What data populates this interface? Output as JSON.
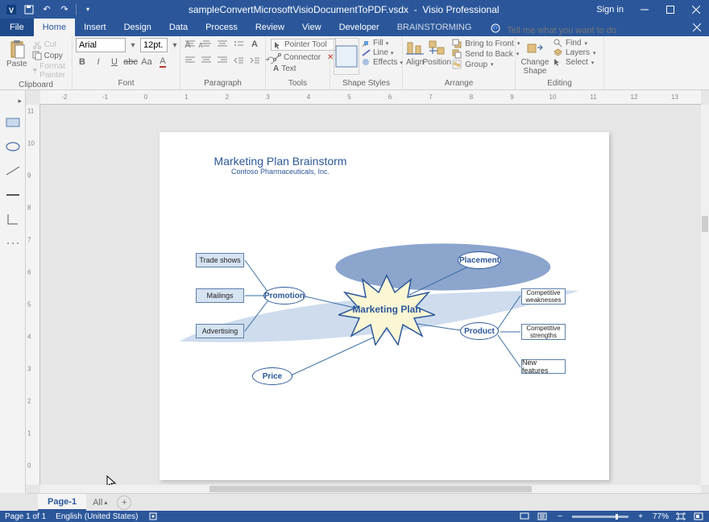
{
  "title": {
    "filename": "sampleConvertMicrosoftVisioDocumentToPDF.vsdx",
    "app": "Visio Professional",
    "signin": "Sign in"
  },
  "tabs": {
    "file": "File",
    "home": "Home",
    "insert": "Insert",
    "design": "Design",
    "data": "Data",
    "process": "Process",
    "review": "Review",
    "view": "View",
    "developer": "Developer",
    "brainstorming": "BRAINSTORMING",
    "tellme": "Tell me what you want to do"
  },
  "ribbon": {
    "clipboard": {
      "paste": "Paste",
      "cut": "Cut",
      "copy": "Copy",
      "format_painter": "Format Painter",
      "label": "Clipboard"
    },
    "font": {
      "name": "Arial",
      "size": "12pt.",
      "label": "Font"
    },
    "paragraph": {
      "label": "Paragraph"
    },
    "tools": {
      "pointer": "Pointer Tool",
      "connector": "Connector",
      "text": "Text",
      "label": "Tools"
    },
    "shapestyles": {
      "quick": "Quick\nStyles",
      "fill": "Fill",
      "line": "Line",
      "effects": "Effects",
      "label": "Shape Styles"
    },
    "arrange": {
      "align": "Align",
      "position": "Position",
      "bring_front": "Bring to Front",
      "send_back": "Send to Back",
      "group": "Group",
      "label": "Arrange"
    },
    "editing": {
      "change_shape": "Change\nShape",
      "find": "Find",
      "layers": "Layers",
      "select": "Select",
      "label": "Editing"
    }
  },
  "ruler_h": [
    "-2",
    "-1",
    "0",
    "1",
    "2",
    "3",
    "4",
    "5",
    "6",
    "7",
    "8",
    "9",
    "10",
    "11",
    "12",
    "13"
  ],
  "ruler_v": [
    "11",
    "10",
    "9",
    "8",
    "7",
    "6",
    "5",
    "4",
    "3",
    "2",
    "1",
    "0"
  ],
  "diagram": {
    "title": "Marketing Plan Brainstorm",
    "subtitle": "Contoso Pharmaceuticals, Inc.",
    "center": "Marketing Plan",
    "promotion": "Promotion",
    "price": "Price",
    "placement": "Placement",
    "product": "Product",
    "trade_shows": "Trade shows",
    "mailings": "Mailings",
    "advertising": "Advertising",
    "comp_weak": "Competitive weaknesses",
    "comp_str": "Competitive strengths",
    "new_features": "New features"
  },
  "pagetab": {
    "page1": "Page-1",
    "all": "All"
  },
  "status": {
    "page": "Page 1 of 1",
    "lang": "English (United States)",
    "zoom": "77%"
  }
}
